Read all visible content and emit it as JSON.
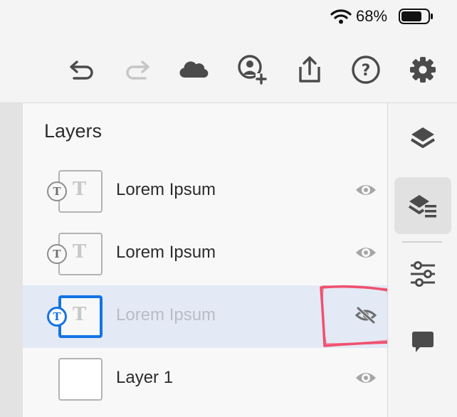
{
  "status_bar": {
    "battery_percent": "68%",
    "icons": [
      "wifi-icon",
      "battery-icon"
    ]
  },
  "toolbar": {
    "buttons": [
      {
        "name": "undo",
        "icon": "undo-icon",
        "enabled": true
      },
      {
        "name": "redo",
        "icon": "redo-icon",
        "enabled": false
      },
      {
        "name": "cloud",
        "icon": "cloud-icon",
        "enabled": true
      },
      {
        "name": "invite",
        "icon": "add-user-icon",
        "enabled": true
      },
      {
        "name": "share",
        "icon": "share-icon",
        "enabled": true
      },
      {
        "name": "help",
        "icon": "help-icon",
        "enabled": true
      },
      {
        "name": "settings",
        "icon": "gear-icon",
        "enabled": true
      }
    ]
  },
  "layers_panel": {
    "title": "Layers",
    "layers": [
      {
        "name": "Lorem Ipsum",
        "type": "text",
        "visible": true,
        "selected": false
      },
      {
        "name": "Lorem Ipsum",
        "type": "text",
        "visible": true,
        "selected": false
      },
      {
        "name": "Lorem Ipsum",
        "type": "text",
        "visible": false,
        "selected": true
      },
      {
        "name": "Layer 1",
        "type": "pixel",
        "visible": true,
        "selected": false
      }
    ]
  },
  "right_rail": {
    "items": [
      {
        "name": "layers",
        "icon": "layers-icon",
        "active": false
      },
      {
        "name": "layer-properties",
        "icon": "layers-list-icon",
        "active": true
      },
      {
        "name": "adjustments",
        "icon": "sliders-icon",
        "active": false
      },
      {
        "name": "comments",
        "icon": "comment-icon",
        "active": false
      }
    ]
  },
  "colors": {
    "accent": "#1473e6",
    "selected_row": "#e3e9f5",
    "annotation": "#f0506e",
    "icon": "#505050"
  }
}
